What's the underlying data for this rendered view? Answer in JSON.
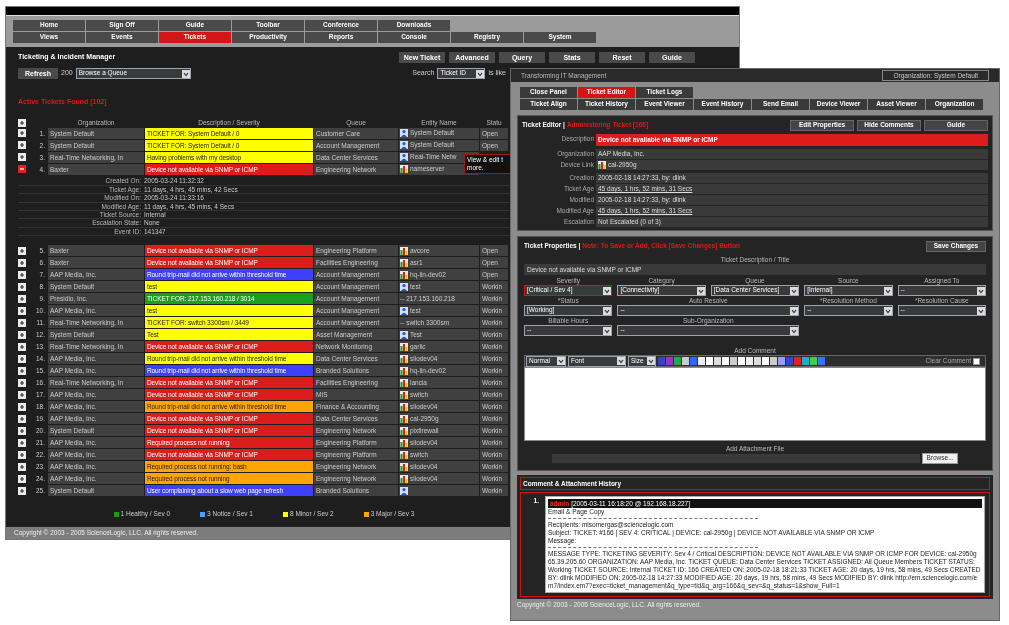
{
  "main_window": {
    "nav_rows": [
      [
        {
          "label": "Home",
          "selected": false
        },
        {
          "label": "Sign Off",
          "selected": false
        },
        {
          "label": "Guide",
          "selected": false
        },
        {
          "label": "Toolbar",
          "selected": false
        },
        {
          "label": "Conference",
          "selected": false
        },
        {
          "label": "Downloads",
          "selected": false
        }
      ],
      [
        {
          "label": "Views",
          "selected": false
        },
        {
          "label": "Events",
          "selected": false
        },
        {
          "label": "Tickets",
          "selected": true
        },
        {
          "label": "Productivity",
          "selected": false
        },
        {
          "label": "Reports",
          "selected": false
        },
        {
          "label": "Console",
          "selected": false
        },
        {
          "label": "Registry",
          "selected": false
        },
        {
          "label": "System",
          "selected": false
        }
      ]
    ],
    "title": "Ticketing & Incident Manager",
    "toolbar_buttons": [
      "New Ticket",
      "Advanced",
      "Query",
      "Stats",
      "Reset",
      "Guide"
    ],
    "refresh_button": "Refresh",
    "page_size": "200",
    "queue_select": "Browse a Queue",
    "search_label": "Search",
    "search_select": "Ticket ID",
    "search_operator": "is like",
    "found_label": "Active Tickets Found [102]",
    "columns": [
      "Organization",
      "Description / Severity",
      "Queue",
      "Entity Name",
      "Statu"
    ],
    "tickets": [
      {
        "number": "1.",
        "organization": "System Default",
        "description": "TICKET FOR: System Default / 0",
        "color": "#ffff00",
        "queue": "Customer Care",
        "kind": "user",
        "entity": "System Default",
        "status": "Open",
        "expanded": false
      },
      {
        "number": "2.",
        "organization": "System Default",
        "description": "TICKET FOR: System Default / 0",
        "color": "#ffff00",
        "queue": "Account Management",
        "kind": "user",
        "entity": "System Default",
        "status": "Open",
        "expanded": false
      },
      {
        "number": "3.",
        "organization": "Real-Time Networking, In",
        "description": "Having problems with my desktop",
        "color": "#ffff00",
        "queue": "Data Center Services",
        "kind": "user",
        "entity": "Real-Time Netw",
        "expanded": false,
        "tooltip": [
          "View & edit t",
          "more."
        ]
      },
      {
        "number": "4.",
        "organization": "Baxter",
        "description": "Device not available via SNMP or ICMP",
        "color": "#dd1c1c",
        "queue": "Engineering Network",
        "kind": "device",
        "entity": "nameserver",
        "expanded": true,
        "details": [
          {
            "label": "Created On:",
            "value": "2005-03-24 11:32:32"
          },
          {
            "label": "Ticket Age:",
            "value": "11 days, 4 hrs, 45 mins, 42 Secs"
          },
          {
            "label": "Modified On:",
            "value": "2005-03-24 11:33:16"
          },
          {
            "label": "Modified Age:",
            "value": "11 days, 4 hrs, 45 mins, 4 Secs"
          },
          {
            "label": "Ticket Source:",
            "value": "Internal"
          },
          {
            "label": "Escalation State:",
            "value": "None"
          },
          {
            "label": "Event ID:",
            "value": "141347"
          }
        ]
      },
      {
        "number": "5.",
        "organization": "Baxter",
        "description": "Device not available via SNMP or ICMP",
        "color": "#dd1c1c",
        "queue": "Engineering Platform",
        "kind": "device",
        "entity": "avcore",
        "status": "Open",
        "expanded": false
      },
      {
        "number": "6.",
        "organization": "Baxter",
        "description": "Device not available via SNMP or ICMP",
        "color": "#dd1c1c",
        "queue": "Facilities Engineering",
        "kind": "device",
        "entity": "asr1",
        "status": "Open",
        "expanded": false
      },
      {
        "number": "7.",
        "organization": "AAP Media, Inc.",
        "description": "Round trip-mail did not arrive within threshold time",
        "color": "#3f3fff",
        "queue": "Account Management",
        "kind": "device",
        "entity": "hq-lin-dev02",
        "status": "Open",
        "expanded": false
      },
      {
        "number": "8.",
        "organization": "System Default",
        "description": "test",
        "color": "#ffff00",
        "queue": "Account Management",
        "kind": "user",
        "entity": "test",
        "status": "Workin",
        "expanded": false
      },
      {
        "number": "9.",
        "organization": "Presidio, Inc.",
        "description": "TICKET FOR: 217.153.160.218 / 3014",
        "color": "#1aa01a",
        "queue": "Account Management",
        "kind": "none",
        "entity": "-- 217.153.160.218",
        "status": "Workin",
        "expanded": false
      },
      {
        "number": "10.",
        "organization": "AAP Media, Inc.",
        "description": "test",
        "color": "#ffff00",
        "queue": "Account Management",
        "kind": "user",
        "entity": "test",
        "status": "Workin",
        "expanded": false
      },
      {
        "number": "11.",
        "organization": "Real-Time Networking, In",
        "description": "TICKET FOR: switch 3300sm / 3449",
        "color": "#ffff00",
        "queue": "Account Management",
        "kind": "none",
        "entity": "-- switch 3300sm",
        "status": "Workin",
        "expanded": false
      },
      {
        "number": "12.",
        "organization": "System Default",
        "description": "Test",
        "color": "#ffff00",
        "queue": "Asset Management",
        "kind": "user",
        "entity": "Test",
        "status": "Workin",
        "expanded": false
      },
      {
        "number": "13.",
        "organization": "Real-Time Networking, In",
        "description": "Device not available via SNMP or ICMP",
        "color": "#dd1c1c",
        "queue": "Network Monitoring",
        "kind": "device",
        "entity": "garlic",
        "status": "Workin",
        "expanded": false
      },
      {
        "number": "14.",
        "organization": "AAP Media, Inc.",
        "description": "Round trip-mail did not arrive within threshold time",
        "color": "#ffff00",
        "queue": "Data Center Services",
        "kind": "device",
        "entity": "silodev04",
        "status": "Workin",
        "expanded": false
      },
      {
        "number": "15.",
        "organization": "AAP Media, Inc.",
        "description": "Round trip-mail did not arrive within threshold time",
        "color": "#3f3fff",
        "queue": "Branded Solutions",
        "kind": "device",
        "entity": "hq-lin-dev02",
        "status": "Workin",
        "expanded": false
      },
      {
        "number": "16.",
        "organization": "Real-Time Networking, In",
        "description": "Device not available via SNMP or ICMP",
        "color": "#dd1c1c",
        "queue": "Facilities Engineering",
        "kind": "device",
        "entity": "lancia",
        "status": "Workin",
        "expanded": false
      },
      {
        "number": "17.",
        "organization": "AAP Media, Inc.",
        "description": "Device not available via SNMP or ICMP",
        "color": "#dd1c1c",
        "queue": "MIS",
        "kind": "device",
        "entity": "switch",
        "status": "Workin",
        "expanded": false
      },
      {
        "number": "18.",
        "organization": "AAP Media, Inc.",
        "description": "Round trip-mail did not arrive within threshold time",
        "color": "#ffa500",
        "queue": "Finance & Accounting",
        "kind": "device",
        "entity": "silodev04",
        "status": "Workin",
        "expanded": false
      },
      {
        "number": "19.",
        "organization": "AAP Media, Inc.",
        "description": "Device not available via SNMP or ICMP",
        "color": "#dd1c1c",
        "queue": "Data Center Services",
        "kind": "device",
        "entity": "cal-2950g",
        "status": "Workin",
        "expanded": false
      },
      {
        "number": "20.",
        "organization": "System Default",
        "description": "Device not available via SNMP or ICMP",
        "color": "#dd1c1c",
        "queue": "Engineering Network",
        "kind": "device",
        "entity": "pixfirewall",
        "status": "Workin",
        "expanded": false
      },
      {
        "number": "21.",
        "organization": "AAP Media, Inc.",
        "description": "Required process not running",
        "color": "#dd1c1c",
        "queue": "Engineering Platform",
        "kind": "device",
        "entity": "silodev04",
        "status": "Workin",
        "expanded": false
      },
      {
        "number": "22.",
        "organization": "AAP Media, Inc.",
        "description": "Device not available via SNMP or ICMP",
        "color": "#dd1c1c",
        "queue": "Engineering Platform",
        "kind": "device",
        "entity": "switch",
        "status": "Workin",
        "expanded": false
      },
      {
        "number": "23.",
        "organization": "AAP Media, Inc.",
        "description": "Required process not running: bash",
        "color": "#ffa500",
        "queue": "Engineering Network",
        "kind": "device",
        "entity": "silodev04",
        "status": "Workin",
        "expanded": false
      },
      {
        "number": "24.",
        "organization": "AAP Media, Inc.",
        "description": "Required process not running",
        "color": "#ffa500",
        "queue": "Engineering Network",
        "kind": "device",
        "entity": "silodev04",
        "status": "Workin",
        "expanded": false
      },
      {
        "number": "25.",
        "organization": "System Default",
        "description": "User complaining about a slow web page refresh",
        "color": "#3f3fff",
        "queue": "Branded Solutions",
        "kind": "user",
        "status": "Workin",
        "expanded": false
      }
    ],
    "legend": [
      {
        "label": "1 Healthy / Sev 0",
        "color": "#1a9a1a"
      },
      {
        "label": "3 Notice / Sev 1",
        "color": "#4aa0ff"
      },
      {
        "label": "8 Minor / Sev 2",
        "color": "#ffff00"
      },
      {
        "label": "3 Major / Sev 3",
        "color": "#ffa500"
      }
    ],
    "copyright": "Copyright © 2003 - 2005 ScienceLogic, LLC. All rights reserved."
  },
  "editor_window": {
    "header_title": "Transforming IT Management",
    "organization_box": "Organization: System Default",
    "tab_rows": [
      [
        {
          "label": "Close Panel",
          "selected": false
        },
        {
          "label": "Ticket Editor",
          "selected": true
        },
        {
          "label": "Ticket Logs",
          "selected": false
        }
      ],
      [
        {
          "label": "Ticket Align",
          "selected": false
        },
        {
          "label": "Ticket History",
          "selected": false
        },
        {
          "label": "Event Viewer",
          "selected": false
        },
        {
          "label": "Event History",
          "selected": false
        },
        {
          "label": "Send Email",
          "selected": false
        },
        {
          "label": "Device Viewer",
          "selected": false
        },
        {
          "label": "Asset Viewer",
          "selected": false
        },
        {
          "label": "Organization",
          "selected": false
        }
      ]
    ],
    "panel_title": "Ticket Editor |",
    "panel_subtitle": "Administering Ticket [166]",
    "panel_buttons": [
      "Edit Properties",
      "Hide Comments",
      "Guide"
    ],
    "field_groups": [
      [
        {
          "label": "Description",
          "value": "Device not available via SNMP or ICMP",
          "kind": "highlight"
        }
      ],
      [
        {
          "label": "Organization",
          "value": "AAP Media, Inc.",
          "kind": "text"
        },
        {
          "label": "Device Link",
          "value": "cal-2950g",
          "kind": "device"
        }
      ],
      [
        {
          "label": "Creation",
          "value": "2005-02-18 14:27:33, by: dlink",
          "kind": "text"
        },
        {
          "label": "Ticket Age",
          "value": "45 days, 1 hrs, 52 mins, 31 Secs",
          "kind": "link"
        },
        {
          "label": "Modified",
          "value": "2005-02-18 14:27:33, by: dlink",
          "kind": "text"
        },
        {
          "label": "Modified Age",
          "value": "45 days, 1 hrs, 52 mins, 31 Secs",
          "kind": "link"
        },
        {
          "label": "Escalation",
          "value": "Not Escalated (0 of 3)",
          "kind": "text"
        }
      ]
    ],
    "properties_title": "Ticket Properties |",
    "properties_note": "Note: To Save or Add, Click [Save Changes] Button",
    "save_button": "Save Changes",
    "description_label": "Ticket Description / Title",
    "description_value": "Device not available via SNMP or ICMP",
    "select_rows": [
      [
        {
          "label": "Severity",
          "value": "[Critical / Sev 4]",
          "kind": "narrow",
          "focused": true
        },
        {
          "label": "Category",
          "value": "[Connectivity]",
          "kind": "narrow",
          "focused": false
        },
        {
          "label": "Queue",
          "value": "[Data Center Services]",
          "kind": "narrow",
          "focused": false
        },
        {
          "label": "Source",
          "value": "[Internal]",
          "kind": "narrow",
          "focused": false
        },
        {
          "label": "Assigned To",
          "value": "--",
          "kind": "narrow",
          "focused": false
        }
      ],
      [
        {
          "label": "*Status",
          "value": "[Working]",
          "kind": "narrow",
          "focused": false
        },
        {
          "label": "Auto Resolve",
          "value": "--",
          "kind": "wide",
          "focused": false
        },
        {
          "label": "*Resolution Method",
          "value": "--",
          "kind": "narrow",
          "focused": false
        },
        {
          "label": "*Resolution Cause",
          "value": "--",
          "kind": "narrow",
          "focused": false
        }
      ],
      [
        {
          "label": "Billable Hours",
          "value": "--",
          "kind": "narrow",
          "focused": false
        },
        {
          "label": "Sub-Organization",
          "value": "--",
          "kind": "wide",
          "focused": false
        }
      ]
    ],
    "comment_label": "Add Comment",
    "format_selects": [
      "Normal",
      "Font",
      "Size"
    ],
    "clear_comment_label": "Clear Comment",
    "clear_comment_checked": false,
    "attachment_label": "Add Attachment File",
    "browse_button": "Browse...",
    "history_title": "Comment & Attachment History",
    "comments": [
      {
        "number": "1.",
        "author": "admin",
        "stamp": "[2005-03-11 16:18:20 @ 192.168.18.227]",
        "heading": "Email & Page Copy",
        "recipients": "Recipients: mlsomergas@sciencelogic.com",
        "subject": "Subject: TICKET: #166 | SEV 4: CRITICAL | DEVICE: cal-2950g | DEVICE NOT AVAILABLE VIA SNMP OR ICMP",
        "message_label": "Message:",
        "message": "MESSAGE TYPE: TICKETING SEVERITY: Sev 4 / Critical DESCRIPTION: DEVICE NOT AVAILABLE VIA SNMP OR ICMP FOR DEVICE: cal-2950g 65.39.205.60 ORGANIZATION: AAP Media, Inc. TICKET QUEUE: Data Center Services TICKET ASSIGNED: All Queue Members TICKET STATUS: Working TICKET SOURCE: Internal TICKET ID: 166 CREATED ON: 2005-02-18 18:21:33 TICKET AGE: 20 days, 19 hrs, 58 mins, 49 Secs CREATED BY: dlink MODIFIED ON: 2005-02-18 14:27:33 MODIFIED AGE: 20 days, 19 hrs, 58 mins, 49 Secs MODIFIED BY: dlink http://em.sciencelogic.com/em7/index.em7?exec=ticket_management&q_type=tid&q_arg=166&q_sev=&q_status=1&show_Full=1"
      }
    ],
    "copyright": "Copyright © 2003 - 2005 ScienceLogic, LLC. All rights reserved."
  }
}
